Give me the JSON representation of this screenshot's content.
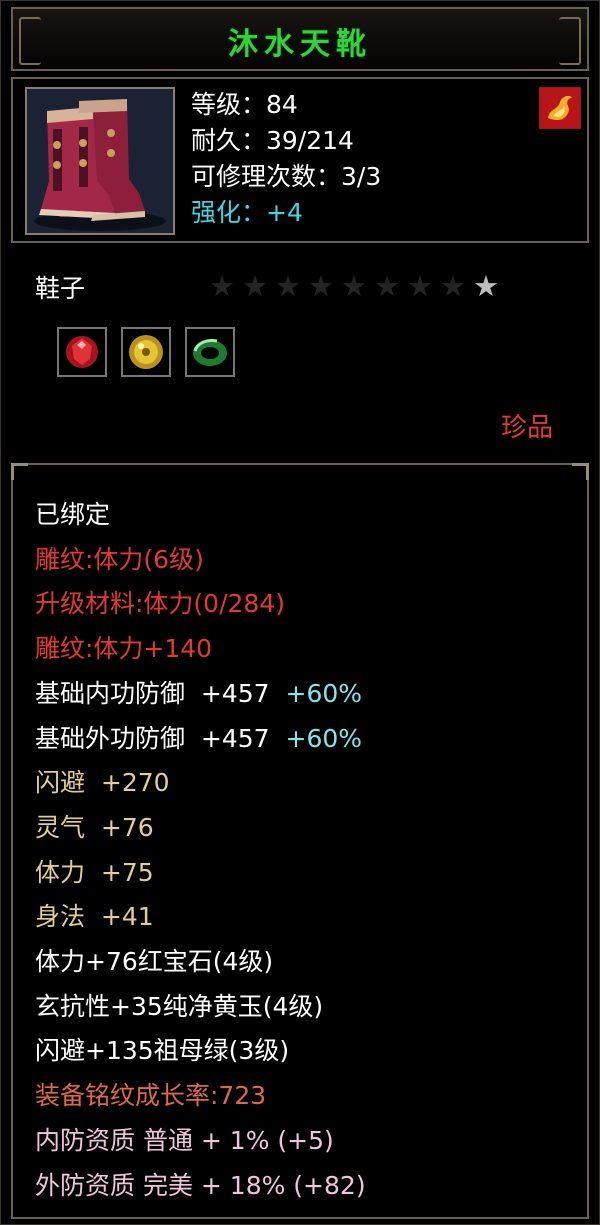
{
  "title": "沐水天靴",
  "item": {
    "icon": "boots-icon",
    "stats": {
      "level": "等级：84",
      "durability": "耐久：39/214",
      "repair_count": "可修理次数：3/3",
      "enhance_label": "强化：",
      "enhance_value": "+4"
    },
    "corner_icon": "fire-icon",
    "type": "鞋子",
    "stars": {
      "total": 9,
      "lit": 1
    },
    "gems": [
      {
        "icon": "ruby-gem-icon",
        "color": "#c8202a"
      },
      {
        "icon": "topaz-gem-icon",
        "color": "#d4b420"
      },
      {
        "icon": "emerald-gem-icon",
        "color": "#2ea046"
      }
    ],
    "grade": "珍品"
  },
  "attributes": {
    "bound": "已绑定",
    "carving": "雕纹:体力(6级)",
    "upgrade_material": "升级材料:体力(0/284)",
    "carving_bonus": "雕纹:体力+140",
    "inner_def": {
      "label": "基础内功防御",
      "value": "+457",
      "pct": "+60%"
    },
    "outer_def": {
      "label": "基础外功防御",
      "value": "+457",
      "pct": "+60%"
    },
    "dodge": {
      "label": "闪避",
      "value": "+270"
    },
    "spirit": {
      "label": "灵气",
      "value": "+76"
    },
    "stamina": {
      "label": "体力",
      "value": "+75"
    },
    "agility": {
      "label": "身法",
      "value": "+41"
    },
    "gem_stamina": "体力+76红宝石(4级)",
    "gem_resist": "玄抗性+35纯净黄玉(4级)",
    "gem_dodge": "闪避+135祖母绿(3级)",
    "growth": "装备铭纹成长率:723",
    "inner_quality": "内防资质 普通 + 1% (+5)",
    "outer_quality": "外防资质 完美 + 18% (+82)"
  },
  "colors": {
    "title_green": "#2fd43a",
    "red": "#e23a30",
    "yellow": "#e2cf8e",
    "orange": "#dd6a42",
    "pink": "#efc5de",
    "cyan": "#40d6e4"
  }
}
